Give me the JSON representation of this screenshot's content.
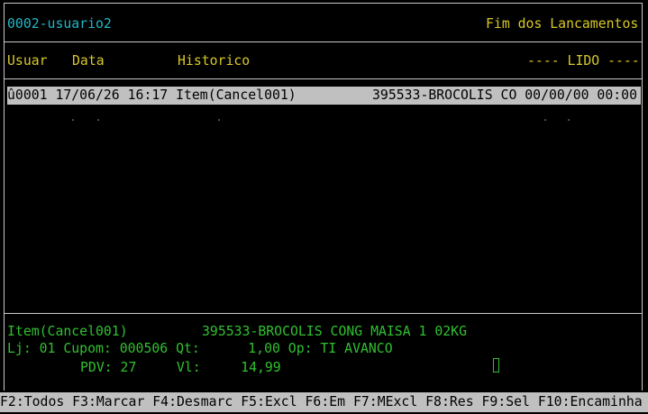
{
  "header": {
    "user_code": "0002-usuario2",
    "status": "Fim dos Lancamentos"
  },
  "columns": {
    "usuar": "Usuar",
    "data": "Data",
    "historico": "Historico",
    "lido": "---- LIDO ----"
  },
  "rows": [
    {
      "left": "û0001 17/06/26 16:17 Item(Cancel001)",
      "right": "395533-BROCOLIS CO 00/00/00 00:00"
    }
  ],
  "detail": {
    "line1_left": "Item(Cancel001)",
    "line1_right": "395533-BROCOLIS CONG MAISA 1 02KG",
    "line2": "Lj: 01 Cupom: 000506 Qt:      1,00 Op: TI AVANCO",
    "line3": "PDV: 27     Vl:     14,99"
  },
  "function_keys": "F2:Todos F3:Marcar F4:Desmarc F5:Excl F6:Em F7:MExcl F8:Res F9:Sel F10:Encaminha",
  "colors": {
    "header_text": "#20b8c8",
    "label_text": "#d8c828",
    "detail_text": "#30c030",
    "selection_bg": "#c0c0c0"
  }
}
